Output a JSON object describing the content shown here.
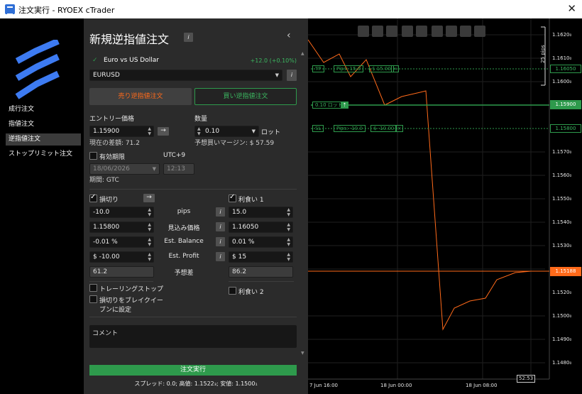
{
  "window": {
    "title": "注文実行 - RYOEX cTrader"
  },
  "nav": {
    "items": [
      "成行注文",
      "指値注文",
      "逆指値注文",
      "ストップリミット注文"
    ],
    "active_index": 2
  },
  "panel": {
    "heading": "新規逆指値注文",
    "symbol_name": "Euro vs US Dollar",
    "change": "+12.0 (+0.10%)",
    "symbol": "EURUSD",
    "sell_button": "売り逆指値注文",
    "buy_button": "買い逆指値注文",
    "entry_label": "エントリー価格",
    "entry_value": "1.15900",
    "entry_diff": "現在の差額: 71.2",
    "qty_label": "数量",
    "qty_value": "0.10",
    "qty_unit": "ロット",
    "margin": "予想買いマージン: $ 57.59",
    "expiry_label": "有効期限",
    "timezone": "UTC+9",
    "expiry_date": "18/06/2026",
    "expiry_time": "12:13",
    "period": "期間: GTC",
    "sl_label": "損切り",
    "tp_label": "利食い 1",
    "rows": {
      "labels": [
        "pips",
        "見込み価格",
        "Est. Balance",
        "Est. Profit",
        "予想差"
      ],
      "sl_values": [
        "-10.0",
        "1.15800",
        "-0.01 %",
        "$ -10.00",
        "61.2"
      ],
      "tp_values": [
        "15.0",
        "1.16050",
        "0.01 %",
        "$ 15",
        "86.2"
      ]
    },
    "trailing_stop": "トレーリングストップ",
    "tp2_label": "利食い 2",
    "breakeven_line1": "損切りをブレイクイー",
    "breakeven_line2": "ブンに設定",
    "comment_placeholder": "コメント",
    "execute_button": "注文実行",
    "footer": "スプレッド: 0.0; 高値: 1.1522₃; 安値: 1.1500₁"
  },
  "chart": {
    "price_labels": [
      "1.1620₀",
      "1.1610₀",
      "1.1600₀",
      "1.1570₀",
      "1.1560₀",
      "1.1550₀",
      "1.1540₀",
      "1.1530₀",
      "1.1520₀",
      "1.1500₀",
      "1.1490₀",
      "1.1480₀"
    ],
    "time_labels": [
      "7 Jun 16:00",
      "18 Jun 00:00",
      "18 Jun 08:00"
    ],
    "time_cursor": "52:53",
    "pips_label": "25 pips",
    "tp_line": "TP",
    "tp_pips": "Pips: 15.0",
    "tp_amount": "$ 15.00",
    "tp_price": "1.16050",
    "entry_line": "0.10 ロット",
    "entry_price": "1.15900",
    "sl_line": "SL",
    "sl_pips": "Pips: -10.0",
    "sl_amount": "$ -10.00",
    "sl_price": "1.15800",
    "current_price": "1.15188",
    "accent_green": "#2e9a4c",
    "accent_orange": "#ff6a1a"
  }
}
